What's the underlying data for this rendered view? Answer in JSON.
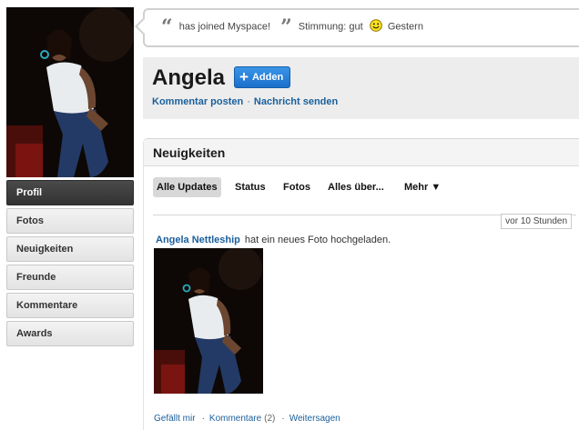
{
  "status": {
    "joined_text": "has joined Myspace!",
    "mood_label": "Stimmung: gut",
    "mood_icon": "smiley-icon",
    "time": "Gestern"
  },
  "profile": {
    "name": "Angela",
    "add_label": "Adden",
    "links": [
      "Kommentar posten",
      "Nachricht senden"
    ]
  },
  "sidebar": {
    "items": [
      {
        "label": "Profil",
        "active": true
      },
      {
        "label": "Fotos"
      },
      {
        "label": "Neuigkeiten"
      },
      {
        "label": "Freunde"
      },
      {
        "label": "Kommentare"
      },
      {
        "label": "Awards"
      }
    ]
  },
  "news": {
    "title": "Neuigkeiten",
    "tabs": [
      {
        "label": "Alle Updates",
        "active": true
      },
      {
        "label": "Status"
      },
      {
        "label": "Fotos"
      },
      {
        "label": "Alles über..."
      },
      {
        "label": "Mehr ▼"
      }
    ],
    "timestamp": "vor 10 Stunden",
    "item": {
      "author": "Angela Nettleship",
      "action": "hat ein neues Foto hochgeladen.",
      "actions": {
        "like": "Gefällt mir",
        "comments": "Kommentare",
        "comment_count": "(2)",
        "share": "Weitersagen"
      }
    }
  },
  "colors": {
    "link_blue": "#1a5f9c",
    "button_blue": "#1b6fcb",
    "active_nav": "#3a3a3a"
  }
}
